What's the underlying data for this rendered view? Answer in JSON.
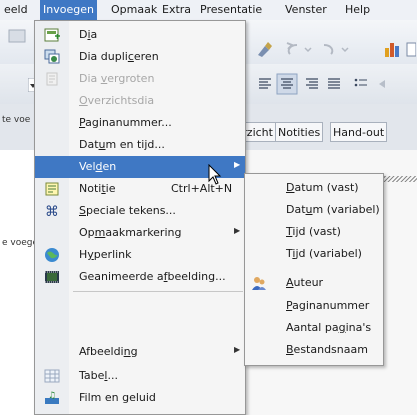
{
  "menubar": {
    "items": [
      {
        "label": "eeld"
      },
      {
        "label": "Invoegen"
      },
      {
        "label": "Opmaak"
      },
      {
        "label": "Extra"
      },
      {
        "label": "Presentatie"
      },
      {
        "label": "Venster"
      },
      {
        "label": "Help"
      }
    ]
  },
  "tabs": {
    "overview": "verzicht",
    "notes": "Notities",
    "handout": "Hand-out"
  },
  "sidebar_text": {
    "top": "te voe",
    "bottom": "e voege"
  },
  "insert_menu": {
    "items": [
      {
        "pre": "D",
        "key": "i",
        "post": "a"
      },
      {
        "pre": "Dia dupli",
        "key": "c",
        "post": "eren"
      },
      {
        "pre": "Dia ",
        "key": "v",
        "post": "ergroten"
      },
      {
        "pre": "",
        "key": "O",
        "post": "verzichtsdia"
      },
      {
        "pre": "",
        "key": "P",
        "post": "aginanummer..."
      },
      {
        "pre": "Dat",
        "key": "u",
        "post": "m en tijd..."
      },
      {
        "pre": "Vel",
        "key": "d",
        "post": "en"
      },
      {
        "pre": "Noti",
        "key": "t",
        "post": "ie",
        "shortcut": "Ctrl+Alt+N"
      },
      {
        "pre": "",
        "key": "S",
        "post": "peciale tekens..."
      },
      {
        "pre": "Op",
        "key": "m",
        "post": "aakmarkering"
      },
      {
        "pre": "H",
        "key": "y",
        "post": "perlink"
      },
      {
        "pre": "Geanimeerde a",
        "key": "f",
        "post": "beelding..."
      },
      {
        "pre": "Afbeeldi",
        "key": "n",
        "post": "g"
      },
      {
        "pre": "Tabe",
        "key": "l",
        "post": "..."
      },
      {
        "pre": "Film en geluid",
        "key": "",
        "post": ""
      }
    ]
  },
  "fields_submenu": {
    "items": [
      {
        "pre": "",
        "key": "D",
        "post": "atum (vast)"
      },
      {
        "pre": "Dat",
        "key": "u",
        "post": "m (variabel)"
      },
      {
        "pre": "",
        "key": "T",
        "post": "ijd (vast)"
      },
      {
        "pre": "T",
        "key": "i",
        "post": "jd (variabel)"
      },
      {
        "pre": "",
        "key": "A",
        "post": "uteur"
      },
      {
        "pre": "",
        "key": "P",
        "post": "aginanummer"
      },
      {
        "pre": "Aantal pa",
        "key": "g",
        "post": "ina's"
      },
      {
        "pre": "",
        "key": "B",
        "post": "estandsnaam"
      }
    ]
  },
  "colors": {
    "highlight": "#3f78c4",
    "disabled_text": "#a7a7a7"
  }
}
